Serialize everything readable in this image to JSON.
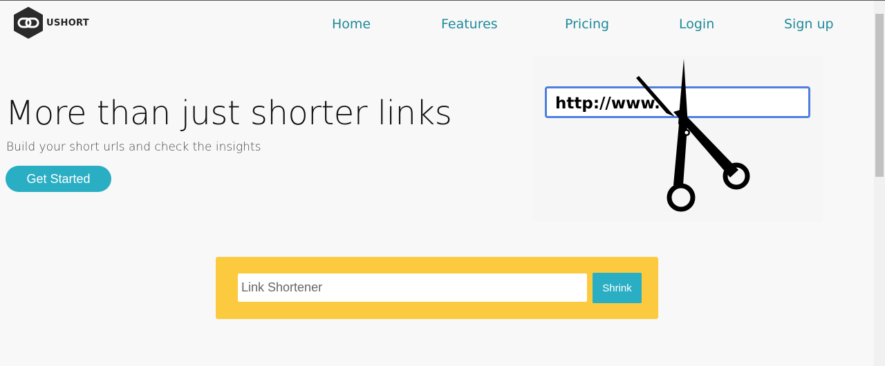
{
  "brand": {
    "name": "USHORT",
    "logo_icon": "chain-link-icon"
  },
  "nav": {
    "items": [
      "Home",
      "Features",
      "Pricing",
      "Login",
      "Sign up"
    ]
  },
  "hero": {
    "title": "More than just shorter links",
    "subtitle": "Build your short urls and check the insights",
    "cta_label": "Get Started"
  },
  "illustration": {
    "url_text": "http://www.",
    "icon": "scissors-icon"
  },
  "shortener": {
    "placeholder": "Link Shortener",
    "value": "",
    "button_label": "Shrink"
  },
  "colors": {
    "accent": "#2aaec3",
    "nav_link": "#1e8a9a",
    "shortener_bg": "#fcca3f",
    "url_border": "#4d7ee0",
    "page_bg": "#f8f8f8"
  }
}
